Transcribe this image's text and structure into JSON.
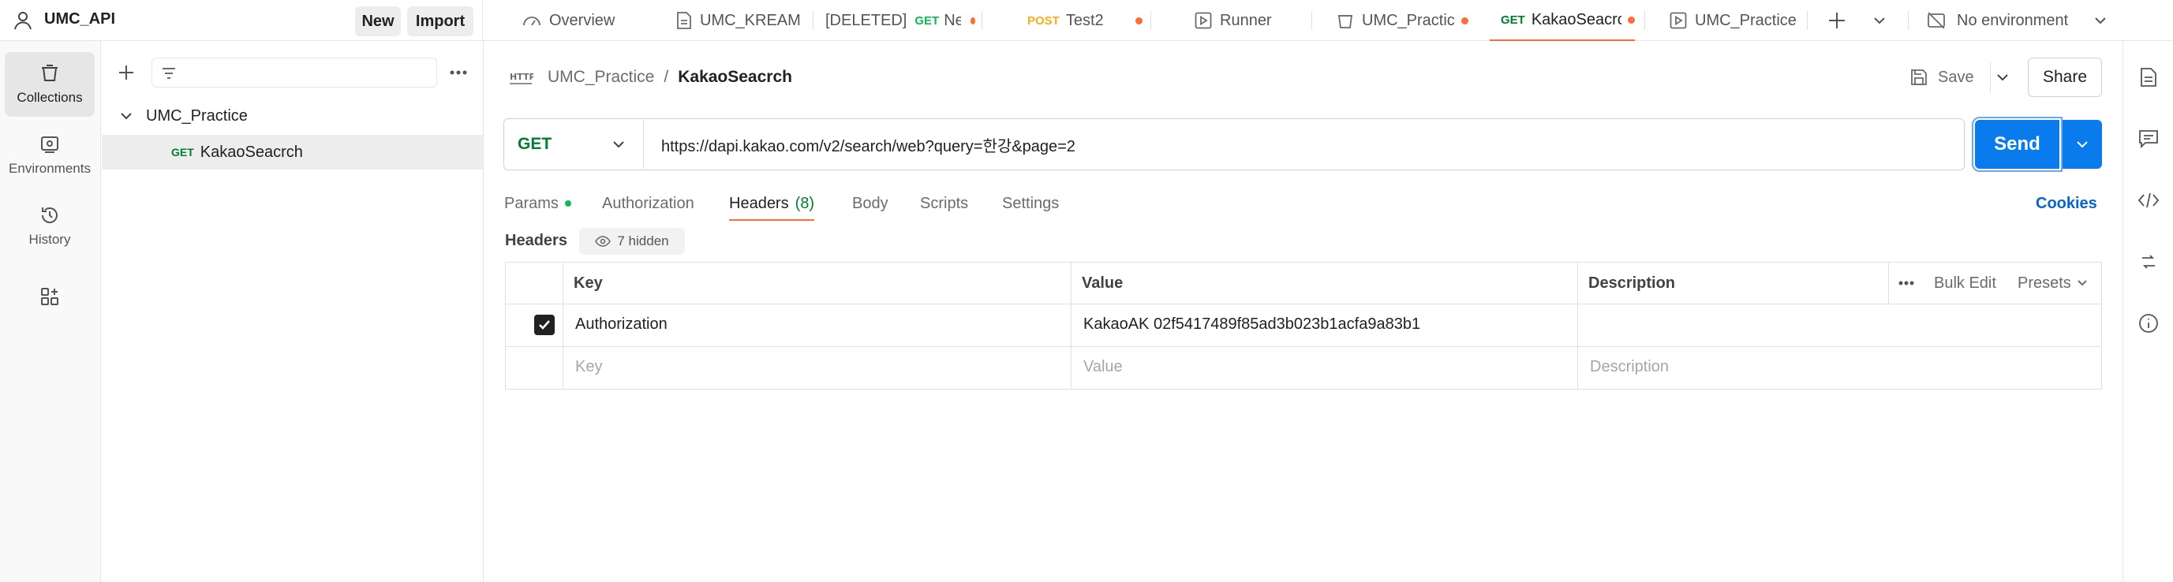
{
  "workspace": {
    "name": "UMC_API",
    "new_label": "New",
    "import_label": "Import"
  },
  "tabs": [
    {
      "label": "Overview",
      "icon": "overview-icon"
    },
    {
      "label": "UMC_KREAM",
      "icon": "document-icon"
    },
    {
      "label": "[DELETED]",
      "method": "GET",
      "suffix": "Nev",
      "unsaved": true
    },
    {
      "method": "POST",
      "label": "Test2",
      "unsaved": true
    },
    {
      "label": "Runner",
      "icon": "runner-icon"
    },
    {
      "label": "UMC_Practice",
      "icon": "collection-icon",
      "unsaved": true
    },
    {
      "method": "GET",
      "label": "KakaoSeacrch",
      "unsaved": true,
      "active": true
    },
    {
      "label": "UMC_Practice",
      "icon": "runner-icon"
    }
  ],
  "environment": {
    "label": "No environment"
  },
  "nav": [
    {
      "label": "Collections",
      "icon": "collections-icon",
      "active": true
    },
    {
      "label": "Environments",
      "icon": "environments-icon"
    },
    {
      "label": "History",
      "icon": "history-icon"
    },
    {
      "label": "",
      "icon": "add-apps-icon"
    }
  ],
  "sidebar": {
    "collection": "UMC_Practice",
    "requests": [
      {
        "method": "GET",
        "name": "KakaoSeacrch"
      }
    ]
  },
  "request": {
    "breadcrumb": {
      "collection": "UMC_Practice",
      "separator": "/",
      "name": "KakaoSeacrch"
    },
    "save_label": "Save",
    "share_label": "Share",
    "method": "GET",
    "url": "https://dapi.kakao.com/v2/search/web?query=한강&page=2",
    "send_label": "Send",
    "tabs": [
      {
        "label": "Params",
        "dot": true
      },
      {
        "label": "Authorization"
      },
      {
        "label": "Headers",
        "count": "(8)",
        "active": true
      },
      {
        "label": "Body"
      },
      {
        "label": "Scripts"
      },
      {
        "label": "Settings"
      }
    ],
    "cookies_label": "Cookies"
  },
  "headers": {
    "title": "Headers",
    "hidden_label": "7 hidden",
    "columns": {
      "key": "Key",
      "value": "Value",
      "description": "Description"
    },
    "bulk_edit": "Bulk Edit",
    "presets": "Presets",
    "rows": [
      {
        "checked": true,
        "key": "Authorization",
        "value": "KakaoAK 02f5417489f85ad3b023b1acfa9a83b1",
        "description": ""
      }
    ],
    "placeholders": {
      "key": "Key",
      "value": "Value",
      "description": "Description"
    }
  },
  "colors": {
    "accent": "#ff6c37",
    "send": "#097bed",
    "get": "#0cbb52",
    "post": "#ffad14"
  }
}
